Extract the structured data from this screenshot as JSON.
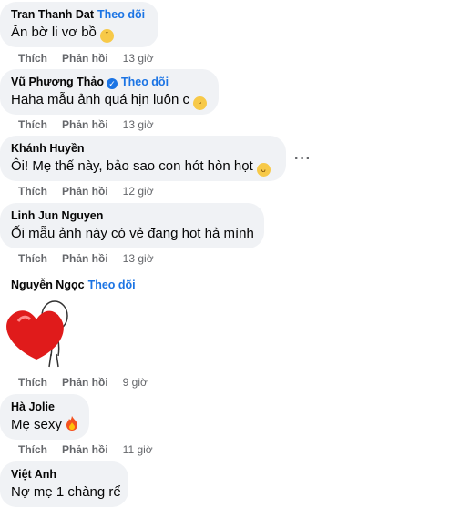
{
  "follow_label": "Theo dõi",
  "like_label": "Thích",
  "reply_label": "Phản hồi",
  "comments": [
    {
      "author": "Tran Thanh Dat",
      "text": "Ăn bờ li vơ bồ",
      "time": "13 giờ",
      "emoji": "crying-face-icon"
    },
    {
      "author": "Vũ Phương Thảo",
      "text": "Haha mẫu ảnh quá hịn luôn c",
      "time": "13 giờ",
      "emoji": "laughing-face-icon",
      "verified": true
    },
    {
      "author": "Khánh Huyền",
      "text": "Ôi! Mẹ thế này, bảo sao con hót hòn họt",
      "time": "12 giờ",
      "emoji": "winking-tongue-face-icon"
    },
    {
      "author": "Linh Jun Nguyen",
      "text": "Ối mẫu ảnh này có vẻ đang hot hả mình",
      "time": "13 giờ"
    },
    {
      "author": "Nguyễn Ngọc",
      "text": "",
      "time": "9 giờ",
      "sticker": "heart-hug-sticker"
    },
    {
      "author": "Hà Jolie",
      "text": "Mẹ sexy",
      "time": "11 giờ",
      "emoji": "fire-icon"
    },
    {
      "author": "Việt Anh",
      "text": "Nợ mẹ 1 chàng rể"
    }
  ],
  "colors": {
    "bubble": "#f0f2f5",
    "link": "#1b74e4",
    "meta": "#65676b"
  }
}
